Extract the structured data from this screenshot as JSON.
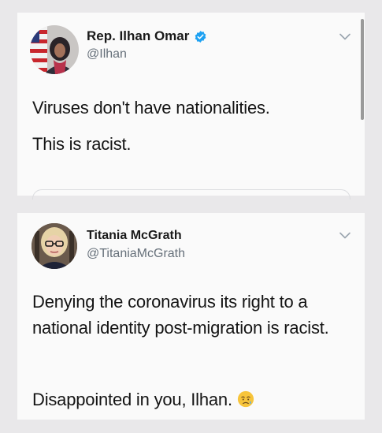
{
  "tweets": [
    {
      "display_name": "Rep. Ilhan Omar",
      "handle": "@Ilhan",
      "verified": true,
      "paragraphs": [
        "Viruses don't have nationalities.",
        "This is racist."
      ]
    },
    {
      "display_name": "Titania McGrath",
      "handle": "@TitaniaMcGrath",
      "verified": false,
      "paragraphs": [
        "Denying the coronavirus its right to a national identity post-migration is racist.",
        "Disappointed in you, Ilhan."
      ],
      "trailing_emoji": "disappointed-relieved-emoji"
    }
  ],
  "icons": {
    "verified_color": "#1da1f2",
    "chevron_color": "#9aa4ae"
  }
}
